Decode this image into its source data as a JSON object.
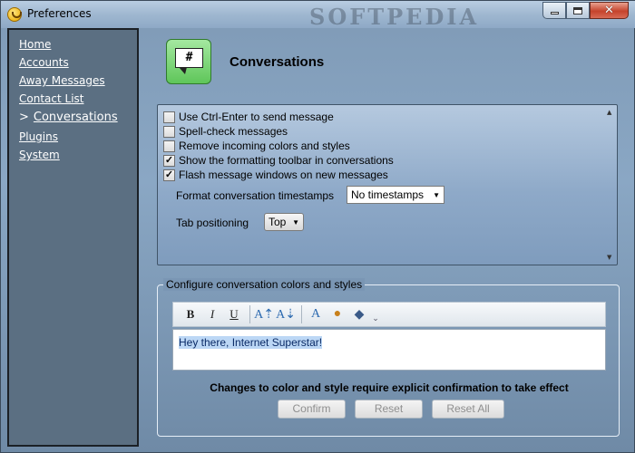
{
  "window": {
    "title": "Preferences",
    "watermark": "SOFTPEDIA",
    "caption_buttons": {
      "close": "✕"
    }
  },
  "sidebar": {
    "items": [
      {
        "label": "Home"
      },
      {
        "label": "Accounts"
      },
      {
        "label": "Away Messages"
      },
      {
        "label": "Contact List"
      },
      {
        "label": "Conversations",
        "prefix": ">",
        "active": true
      },
      {
        "label": "Plugins"
      },
      {
        "label": "System"
      }
    ]
  },
  "header": {
    "icon_symbol": "#",
    "title": "Conversations"
  },
  "options": {
    "checkboxes": [
      {
        "label": "Use Ctrl-Enter to send message",
        "checked": false
      },
      {
        "label": "Spell-check messages",
        "checked": false
      },
      {
        "label": "Remove incoming colors and styles",
        "checked": false
      },
      {
        "label": "Show the formatting toolbar in conversations",
        "checked": true
      },
      {
        "label": "Flash message windows on new messages",
        "checked": true
      }
    ],
    "timestamps": {
      "label": "Format conversation timestamps",
      "value": "No timestamps"
    },
    "tabs": {
      "label": "Tab positioning",
      "value": "Top"
    }
  },
  "style_group": {
    "legend": "Configure conversation colors and styles",
    "toolbar": {
      "bold": "B",
      "italic": "I",
      "underline": "U"
    },
    "preview_text": "Hey there, Internet Superstar!",
    "notice": "Changes to color and style require explicit confirmation to take effect",
    "buttons": {
      "confirm": "Confirm",
      "reset": "Reset",
      "reset_all": "Reset All"
    }
  }
}
